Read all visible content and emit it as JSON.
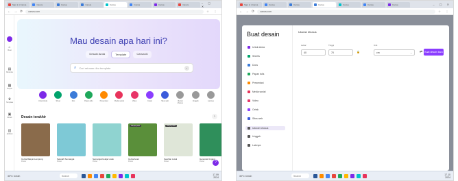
{
  "left": {
    "tabs": [
      {
        "label": "Sign in | Canva",
        "color": "#e8453c",
        "active": false
      },
      {
        "label": "Canva",
        "color": "#4285f4",
        "active": false
      },
      {
        "label": "Canva",
        "color": "#3b7bd8",
        "active": false
      },
      {
        "label": "Canva",
        "color": "#3b7bd8",
        "active": false
      },
      {
        "label": "Canva",
        "color": "#00c4cc",
        "active": true
      },
      {
        "label": "Canva",
        "color": "#4285f4",
        "active": false
      },
      {
        "label": "Canva",
        "color": "#7d2ae8",
        "active": false
      },
      {
        "label": "Canva",
        "color": "#e8453c",
        "active": false
      }
    ],
    "url": "canva.com",
    "hero": {
      "title": "Mau desain apa hari ini?",
      "chips": [
        "Desain Anda",
        "Template",
        "Canva AI"
      ],
      "active_chip": 1,
      "search_placeholder": "Cari ratusan ribu template"
    },
    "rail": [
      "Buat",
      "Beranda",
      "Proyek",
      "Template",
      "Merek",
      "Aplikasi"
    ],
    "categories": [
      {
        "label": "Untuk Anda",
        "color": "#7d2ae8"
      },
      {
        "label": "Sheet",
        "color": "#00a36c"
      },
      {
        "label": "Doc",
        "color": "#3b7bd8"
      },
      {
        "label": "Papan tulis",
        "color": "#1fa85b"
      },
      {
        "label": "Presentasi",
        "color": "#ff8a00"
      },
      {
        "label": "Media sosial",
        "color": "#e8335b"
      },
      {
        "label": "Video",
        "color": "#e83568"
      },
      {
        "label": "Cetak",
        "color": "#8b3dff"
      },
      {
        "label": "Situs web",
        "color": "#3b5bdb"
      },
      {
        "label": "Ukuran khusus",
        "color": "#999999"
      },
      {
        "label": "Unggah",
        "color": "#999999"
      },
      {
        "label": "Lainnya",
        "color": "#999999"
      }
    ],
    "section_title": "Desain terakhir",
    "designs": [
      {
        "name": "Cerita Rakyat Lampung",
        "sub": "Poster",
        "tag": "",
        "bg": "#8a6b4b"
      },
      {
        "name": "Sekolah Semangat",
        "sub": "Poster",
        "tag": "",
        "bg": "#7ec9d6"
      },
      {
        "name": "Semangat belajar anak",
        "sub": "Poster",
        "tag": "",
        "bg": "#8fd3d0"
      },
      {
        "name": "Cerita Anak",
        "sub": "Poster",
        "tag": "Tanpa judul",
        "bg": "#5a8f3a"
      },
      {
        "name": "Kearifan Lokal",
        "sub": "Poster",
        "tag": "Tanpa judul",
        "bg": "#dfe6d8"
      },
      {
        "name": "Generasi Unggul",
        "sub": "Poster",
        "tag": "",
        "bg": "#2f8f5b"
      }
    ],
    "weather": "30°C Cerah",
    "taskbar_search": "Search",
    "tray": "17.09\n2024"
  },
  "right": {
    "tabs": [
      {
        "label": "Sign in | Canva",
        "color": "#e8453c",
        "active": false
      },
      {
        "label": "Canva",
        "color": "#4285f4",
        "active": false
      },
      {
        "label": "Canva",
        "color": "#3b7bd8",
        "active": false
      },
      {
        "label": "Canva",
        "color": "#3b7bd8",
        "active": true
      },
      {
        "label": "Canva",
        "color": "#00c4cc",
        "active": false
      },
      {
        "label": "Canva",
        "color": "#4285f4",
        "active": false
      },
      {
        "label": "Canva",
        "color": "#7d2ae8",
        "active": false
      }
    ],
    "url": "canva.com",
    "modal_title": "Buat desain",
    "menu": [
      {
        "label": "Untuk Anda",
        "color": "#7d2ae8"
      },
      {
        "label": "Sheets",
        "color": "#00a36c"
      },
      {
        "label": "Docs",
        "color": "#3b7bd8"
      },
      {
        "label": "Papan tulis",
        "color": "#1fa85b"
      },
      {
        "label": "Presentasi",
        "color": "#ff8a00"
      },
      {
        "label": "Media sosial",
        "color": "#e8335b"
      },
      {
        "label": "Video",
        "color": "#e83568"
      },
      {
        "label": "Cetak",
        "color": "#8b3dff"
      },
      {
        "label": "Situs web",
        "color": "#3b5bdb"
      },
      {
        "label": "Ukuran khusus",
        "color": "#555555",
        "active": true
      },
      {
        "label": "Unggah",
        "color": "#555555"
      },
      {
        "label": "Lainnya",
        "color": "#555555"
      }
    ],
    "main_title": "Ukuran khusus",
    "width_label": "Lebar",
    "height_label": "Tinggi",
    "unit_label": "Unit",
    "width_value": "40",
    "height_value": "70",
    "unit_value": "cm",
    "create_label": "Buat desain baru",
    "weather": "30°C Cerah",
    "taskbar_search": "Search",
    "tray": "17.10\n2024"
  },
  "taskbar_apps": [
    "#2b5797",
    "#ff8c00",
    "#4285f4",
    "#e8453c",
    "#1fa85b",
    "#ffb900",
    "#7d2ae8",
    "#00c4cc",
    "#e8335b"
  ]
}
